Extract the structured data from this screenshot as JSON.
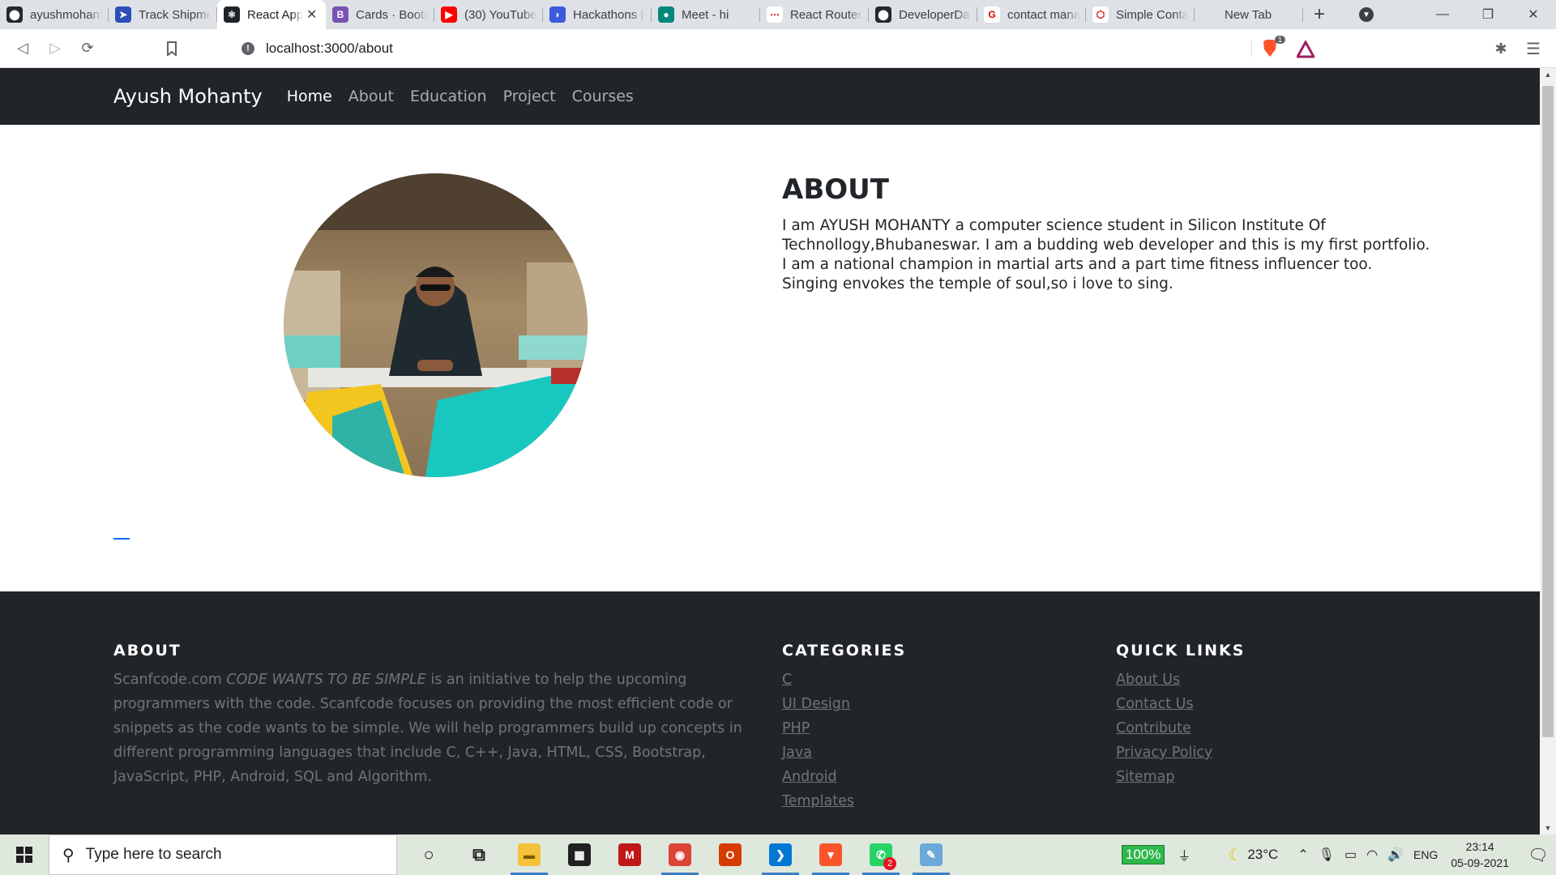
{
  "browser": {
    "tabs": [
      {
        "title": "ayushmohanty",
        "icon": "github-icon",
        "active": false
      },
      {
        "title": "Track Shipment",
        "icon": "runner-icon",
        "active": false
      },
      {
        "title": "React App",
        "icon": "react-icon",
        "active": true
      },
      {
        "title": "Cards · Bootstrap",
        "icon": "bootstrap-icon",
        "active": false
      },
      {
        "title": "(30) YouTube",
        "icon": "youtube-icon",
        "active": false
      },
      {
        "title": "Hackathons |",
        "icon": "hackathon-icon",
        "active": false
      },
      {
        "title": "Meet - hi",
        "icon": "meet-icon",
        "active": false
      },
      {
        "title": "React Router",
        "icon": "react-router-icon",
        "active": false
      },
      {
        "title": "DeveloperDa",
        "icon": "github-icon",
        "active": false
      },
      {
        "title": "contact mana",
        "icon": "google-icon",
        "active": false
      },
      {
        "title": "Simple Conta",
        "icon": "codepen-icon",
        "active": false
      },
      {
        "title": "New Tab",
        "icon": "none",
        "active": false
      }
    ],
    "url": "localhost:3000/about",
    "brave_shield_count": "1"
  },
  "site": {
    "brand": "Ayush Mohanty",
    "nav": [
      "Home",
      "About",
      "Education",
      "Project",
      "Courses"
    ],
    "active_nav": "Home",
    "about": {
      "heading": "ABOUT",
      "text": "I am AYUSH MOHANTY a computer science student in Silicon Institute Of Technollogy,Bhubaneswar. I am a budding web developer and this is my first portfolio. I am a national champion in martial arts and a part time fitness influencer too. Singing envokes the temple of soul,so i love to sing."
    },
    "footer": {
      "about_heading": "ABOUT",
      "about_text_lead": "Scanfcode.com ",
      "about_text_em": "CODE WANTS TO BE SIMPLE",
      "about_text_rest": " is an initiative to help the upcoming programmers with the code. Scanfcode focuses on providing the most efficient code or snippets as the code wants to be simple. We will help programmers build up concepts in different programming languages that include C, C++, Java, HTML, CSS, Bootstrap, JavaScript, PHP, Android, SQL and Algorithm.",
      "categories_heading": "CATEGORIES",
      "categories": [
        "C",
        "UI Design",
        "PHP",
        "Java",
        "Android",
        "Templates"
      ],
      "quicklinks_heading": "QUICK LINKS",
      "quicklinks": [
        "About Us",
        "Contact Us",
        "Contribute",
        "Privacy Policy",
        "Sitemap"
      ]
    }
  },
  "taskbar": {
    "search_placeholder": "Type here to search",
    "apps": [
      {
        "name": "cortana-icon",
        "running": false
      },
      {
        "name": "task-view-icon",
        "running": false
      },
      {
        "name": "file-explorer-icon",
        "running": true
      },
      {
        "name": "microsoft-store-icon",
        "running": false
      },
      {
        "name": "mcafee-icon",
        "running": false
      },
      {
        "name": "chrome-icon",
        "running": true
      },
      {
        "name": "office-icon",
        "running": false
      },
      {
        "name": "vscode-icon",
        "running": true
      },
      {
        "name": "brave-icon",
        "running": true
      },
      {
        "name": "whatsapp-icon",
        "running": true,
        "badge": "2"
      },
      {
        "name": "notepad-icon",
        "running": true
      }
    ],
    "battery": "100%",
    "weather": "23°C",
    "language": "ENG",
    "time": "23:14",
    "date": "05-09-2021"
  },
  "colors": {
    "navbar_bg": "#212529",
    "footer_text": "#737373",
    "accent": "#0d6efd"
  }
}
